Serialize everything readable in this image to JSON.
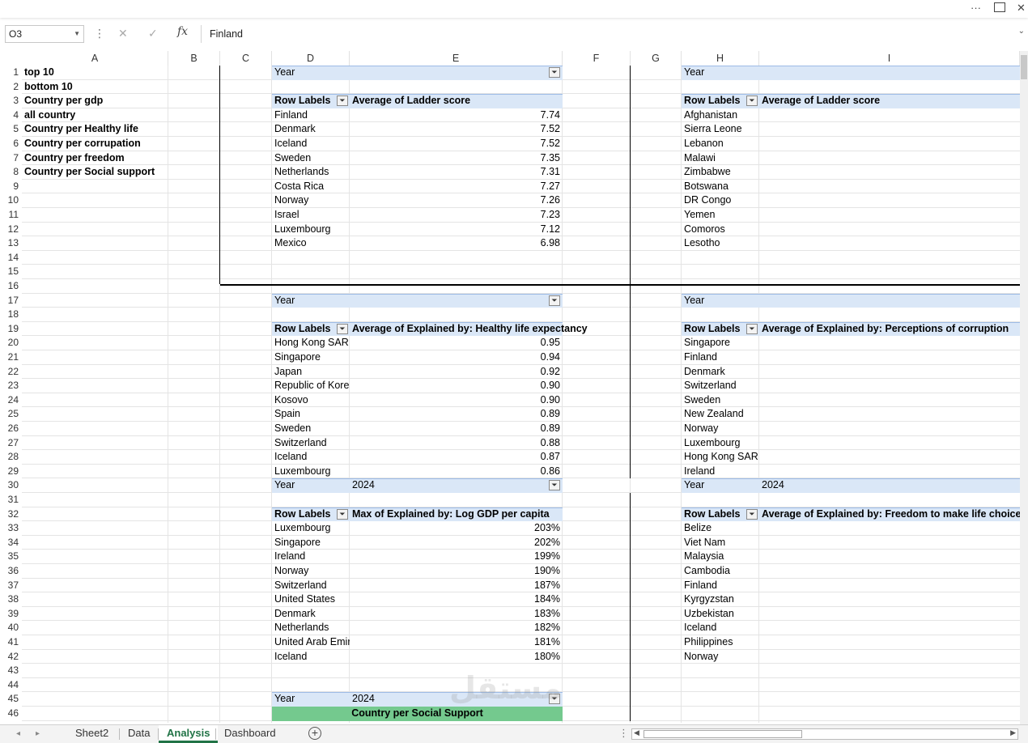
{
  "window": {
    "more_icon": "more-options-icon",
    "restore_icon": "restore-icon",
    "close_icon": "close-icon"
  },
  "formula_bar": {
    "name_box": "O3",
    "fx_label": "fx",
    "formula_value": "Finland"
  },
  "columns": [
    "A",
    "B",
    "C",
    "D",
    "E",
    "F",
    "G",
    "H",
    "I"
  ],
  "rows": [
    "1",
    "2",
    "3",
    "4",
    "5",
    "6",
    "7",
    "8",
    "9",
    "10",
    "11",
    "12",
    "13",
    "14",
    "15",
    "16",
    "17",
    "18",
    "19",
    "20",
    "21",
    "22",
    "23",
    "24",
    "25",
    "26",
    "27",
    "28",
    "29",
    "30",
    "31",
    "32",
    "33",
    "34",
    "35",
    "36",
    "37",
    "38",
    "39",
    "40",
    "41",
    "42",
    "43",
    "44",
    "45",
    "46"
  ],
  "col_a": [
    "top 10",
    "bottom 10",
    "Country per gdp",
    "all country",
    "Country per Healthy life",
    "Country per corrupation",
    "Country per freedom",
    "Country per Social support"
  ],
  "pivot_ladder_top": {
    "year_label": "Year",
    "row_labels": "Row Labels",
    "value_header": "Average of Ladder score",
    "rows": [
      {
        "country": "Finland",
        "value": "7.74"
      },
      {
        "country": "Denmark",
        "value": "7.52"
      },
      {
        "country": "Iceland",
        "value": "7.52"
      },
      {
        "country": "Sweden",
        "value": "7.35"
      },
      {
        "country": "Netherlands",
        "value": "7.31"
      },
      {
        "country": "Costa Rica",
        "value": "7.27"
      },
      {
        "country": "Norway",
        "value": "7.26"
      },
      {
        "country": "Israel",
        "value": "7.23"
      },
      {
        "country": "Luxembourg",
        "value": "7.12"
      },
      {
        "country": "Mexico",
        "value": "6.98"
      }
    ]
  },
  "pivot_ladder_bottom": {
    "year_label": "Year",
    "row_labels": "Row Labels",
    "value_header": "Average of Ladder score",
    "rows": [
      "Afghanistan",
      "Sierra Leone",
      "Lebanon",
      "Malawi",
      "Zimbabwe",
      "Botswana",
      "DR Congo",
      "Yemen",
      "Comoros",
      "Lesotho"
    ]
  },
  "pivot_health": {
    "year_label": "Year",
    "row_labels": "Row Labels",
    "value_header": "Average of Explained by: Healthy life expectancy",
    "rows": [
      {
        "country": "Hong Kong SAR",
        "value": "0.95"
      },
      {
        "country": "Singapore",
        "value": "0.94"
      },
      {
        "country": "Japan",
        "value": "0.92"
      },
      {
        "country": "Republic of Korea",
        "value": "0.90"
      },
      {
        "country": "Kosovo",
        "value": "0.90"
      },
      {
        "country": "Spain",
        "value": "0.89"
      },
      {
        "country": "Sweden",
        "value": "0.89"
      },
      {
        "country": "Switzerland",
        "value": "0.88"
      },
      {
        "country": "Iceland",
        "value": "0.87"
      },
      {
        "country": "Luxembourg",
        "value": "0.86"
      }
    ]
  },
  "pivot_corruption": {
    "year_label": "Year",
    "row_labels": "Row Labels",
    "value_header": "Average of Explained by: Perceptions of corruption",
    "rows": [
      "Singapore",
      "Finland",
      "Denmark",
      "Switzerland",
      "Sweden",
      "New Zealand",
      "Norway",
      "Luxembourg",
      "Hong Kong SAR",
      "Ireland"
    ]
  },
  "pivot_gdp": {
    "year_label": "Year",
    "year_value": "2024",
    "row_labels": "Row Labels",
    "value_header": "Max of Explained by: Log GDP per capita",
    "rows": [
      {
        "country": "Luxembourg",
        "value": "203%"
      },
      {
        "country": "Singapore",
        "value": "202%"
      },
      {
        "country": "Ireland",
        "value": "199%"
      },
      {
        "country": "Norway",
        "value": "190%"
      },
      {
        "country": "Switzerland",
        "value": "187%"
      },
      {
        "country": "United States",
        "value": "184%"
      },
      {
        "country": "Denmark",
        "value": "183%"
      },
      {
        "country": "Netherlands",
        "value": "182%"
      },
      {
        "country": "United Arab Emirates",
        "value": "181%"
      },
      {
        "country": "Iceland",
        "value": "180%"
      }
    ]
  },
  "pivot_freedom": {
    "year_label": "Year",
    "year_value": "2024",
    "row_labels": "Row Labels",
    "value_header": "Average of Explained by: Freedom to make life choices",
    "rows": [
      "Belize",
      "Viet Nam",
      "Malaysia",
      "Cambodia",
      "Finland",
      "Kyrgyzstan",
      "Uzbekistan",
      "Iceland",
      "Philippines",
      "Norway"
    ]
  },
  "pivot_social": {
    "year_label": "Year",
    "year_value": "2024",
    "title": "Country per Social Support"
  },
  "tabs": [
    "Sheet2",
    "Data",
    "Analysis",
    "Dashboard"
  ],
  "active_tab": "Analysis",
  "add_sheet_icon": "plus-icon",
  "colors": {
    "pivot_header": "#dae7f7",
    "green_title": "#74c98e",
    "active_tab": "#217346"
  }
}
